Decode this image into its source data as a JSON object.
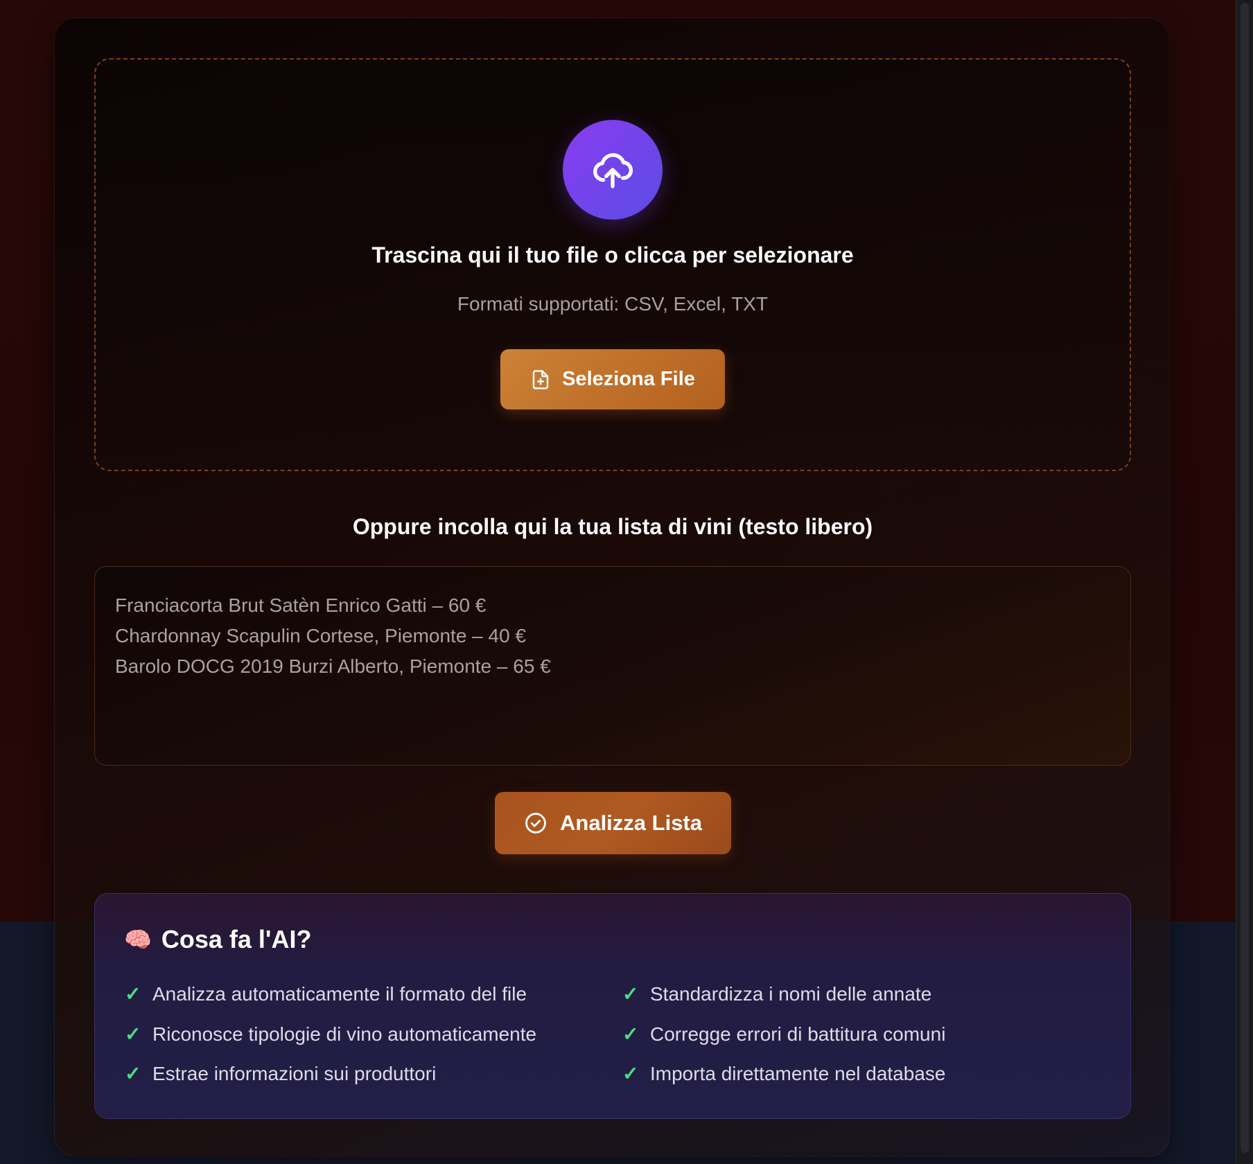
{
  "upload": {
    "icon": "cloud-upload-icon",
    "title": "Trascina qui il tuo file o clicca per selezionare",
    "formats": "Formati supportati: CSV, Excel, TXT",
    "select_button": {
      "icon": "file-plus-icon",
      "label": "Seleziona File"
    }
  },
  "paste": {
    "label": "Oppure incolla qui la tua lista di vini (testo libero)",
    "lines": [
      "Franciacorta Brut Satèn Enrico Gatti – 60 €",
      "Chardonnay Scapulin Cortese, Piemonte – 40 €",
      "Barolo DOCG 2019 Burzi Alberto, Piemonte – 65 €"
    ]
  },
  "analyze_button": {
    "icon": "check-circle-icon",
    "label": "Analizza Lista"
  },
  "ai_info": {
    "emoji": "🧠",
    "title": "Cosa fa l'AI?",
    "check_glyph": "✓",
    "features_left": [
      "Analizza automaticamente il formato del file",
      "Riconosce tipologie di vino automaticamente",
      "Estrae informazioni sui produttori"
    ],
    "features_right": [
      "Standardizza i nomi delle annate",
      "Corregge errori di battitura comuni",
      "Importa direttamente nel database"
    ]
  },
  "colors": {
    "upload_circle": "#7b3fe4",
    "select_button": "#c7772f",
    "analyze_button": "#a8521e",
    "check": "#4ade80",
    "dropzone_border": "#7a4020"
  }
}
